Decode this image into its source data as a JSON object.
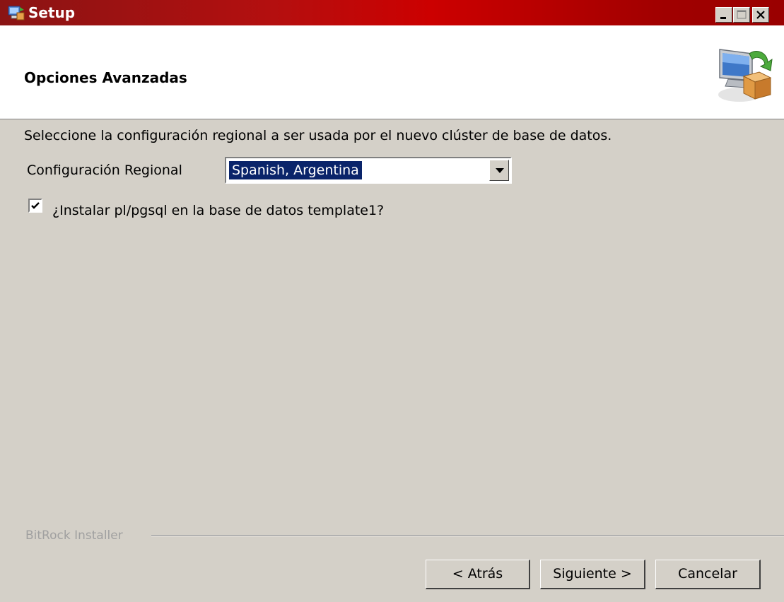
{
  "window": {
    "title": "Setup",
    "controls": {
      "minimize": "minimize",
      "maximize": "maximize",
      "close": "close"
    }
  },
  "header": {
    "title": "Opciones Avanzadas"
  },
  "body": {
    "description": "Seleccione la configuración regional a ser usada por el nuevo clúster de base de datos.",
    "locale_label": "Configuración Regional",
    "locale_value": "Spanish, Argentina",
    "install_checkbox_label": "¿Instalar pl/pgsql en la base de datos template1?",
    "install_checked": true
  },
  "footer": {
    "brand": "BitRock Installer",
    "back_label": "< Atrás",
    "next_label": "Siguiente >",
    "cancel_label": "Cancelar"
  },
  "colors": {
    "titlebar": "#b40f0f",
    "face": "#d4d0c8",
    "selection": "#0a246a"
  }
}
